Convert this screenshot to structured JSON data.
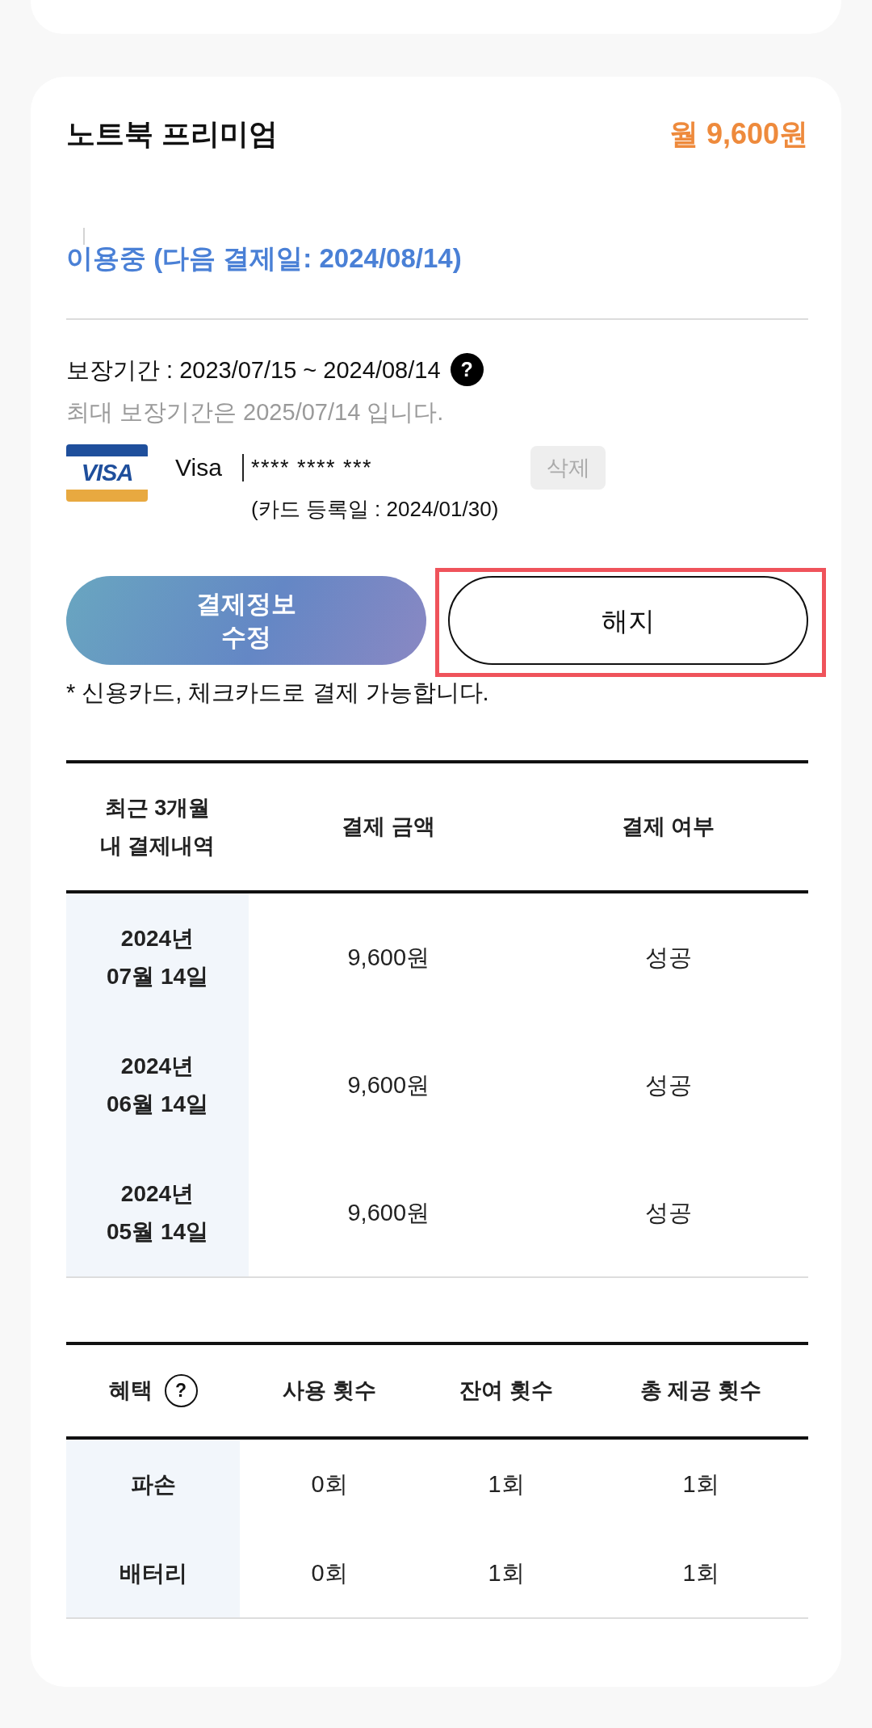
{
  "plan": {
    "name": "노트북 프리미엄",
    "price": "월 9,600원",
    "status": "이용중 (다음 결제일: 2024/08/14)"
  },
  "coverage": {
    "period": "보장기간 : 2023/07/15 ~ 2024/08/14",
    "help_mark": "?",
    "note": "최대 보장기간은 2025/07/14 입니다."
  },
  "payment_card": {
    "logo_text": "VISA",
    "brand": "Visa",
    "number": "**** **** ***",
    "registered": "(카드 등록일 : 2024/01/30)",
    "delete_button": {
      "label": "삭제",
      "disabled": true
    }
  },
  "actions": [
    {
      "kind": "gradient",
      "label": "결제정보\n수정",
      "highlighted": false
    },
    {
      "kind": "outline",
      "label": "해지",
      "highlighted": true
    }
  ],
  "payment_note": "* 신용카드, 체크카드로 결제 가능합니다.",
  "payments": {
    "columns": [
      "최근 3개월\n내 결제내역",
      "결제 금액",
      "결제 여부"
    ],
    "rows": [
      {
        "date": "2024년\n07월 14일",
        "amount": "9,600원",
        "result": "성공"
      },
      {
        "date": "2024년\n06월 14일",
        "amount": "9,600원",
        "result": "성공"
      },
      {
        "date": "2024년\n05월 14일",
        "amount": "9,600원",
        "result": "성공"
      }
    ]
  },
  "benefits": {
    "columns": [
      "혜택",
      "사용 횟수",
      "잔여 횟수",
      "총 제공 횟수"
    ],
    "help_mark": "?",
    "rows": [
      {
        "name": "파손",
        "used": "0회",
        "remaining": "1회",
        "total": "1회"
      },
      {
        "name": "배터리",
        "used": "0회",
        "remaining": "1회",
        "total": "1회"
      }
    ]
  }
}
